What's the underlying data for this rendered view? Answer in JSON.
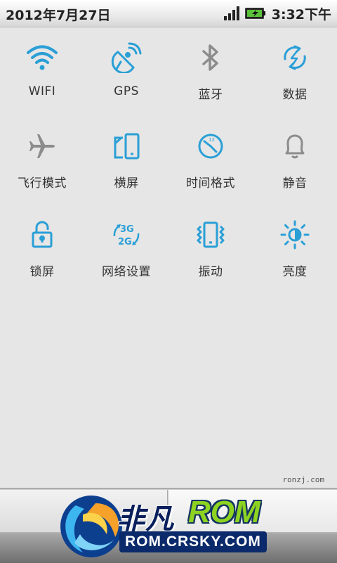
{
  "status_bar": {
    "date": "2012年7月27日",
    "time": "3:32下午"
  },
  "toggles": [
    {
      "label": "WIFI",
      "icon": "wifi-icon",
      "active": true
    },
    {
      "label": "GPS",
      "icon": "gps-icon",
      "active": true
    },
    {
      "label": "蓝牙",
      "icon": "bluetooth-icon",
      "active": false
    },
    {
      "label": "数据",
      "icon": "data-icon",
      "active": true
    },
    {
      "label": "飞行模式",
      "icon": "airplane-icon",
      "active": false
    },
    {
      "label": "横屏",
      "icon": "rotate-screen-icon",
      "active": true
    },
    {
      "label": "时间格式",
      "icon": "clock-icon",
      "active": true
    },
    {
      "label": "静音",
      "icon": "bell-icon",
      "active": false
    },
    {
      "label": "锁屏",
      "icon": "lock-icon",
      "active": true
    },
    {
      "label": "网络设置",
      "icon": "network-3g-2g-icon",
      "active": true
    },
    {
      "label": "振动",
      "icon": "vibrate-icon",
      "active": true
    },
    {
      "label": "亮度",
      "icon": "brightness-icon",
      "active": true
    }
  ],
  "watermark": "ronzj.com",
  "logo": {
    "cn": "非凡",
    "rom": "ROM",
    "url": "ROM.CRSKY.COM"
  },
  "colors": {
    "active": "#2a9fd6",
    "inactive": "#8c8c8c"
  }
}
